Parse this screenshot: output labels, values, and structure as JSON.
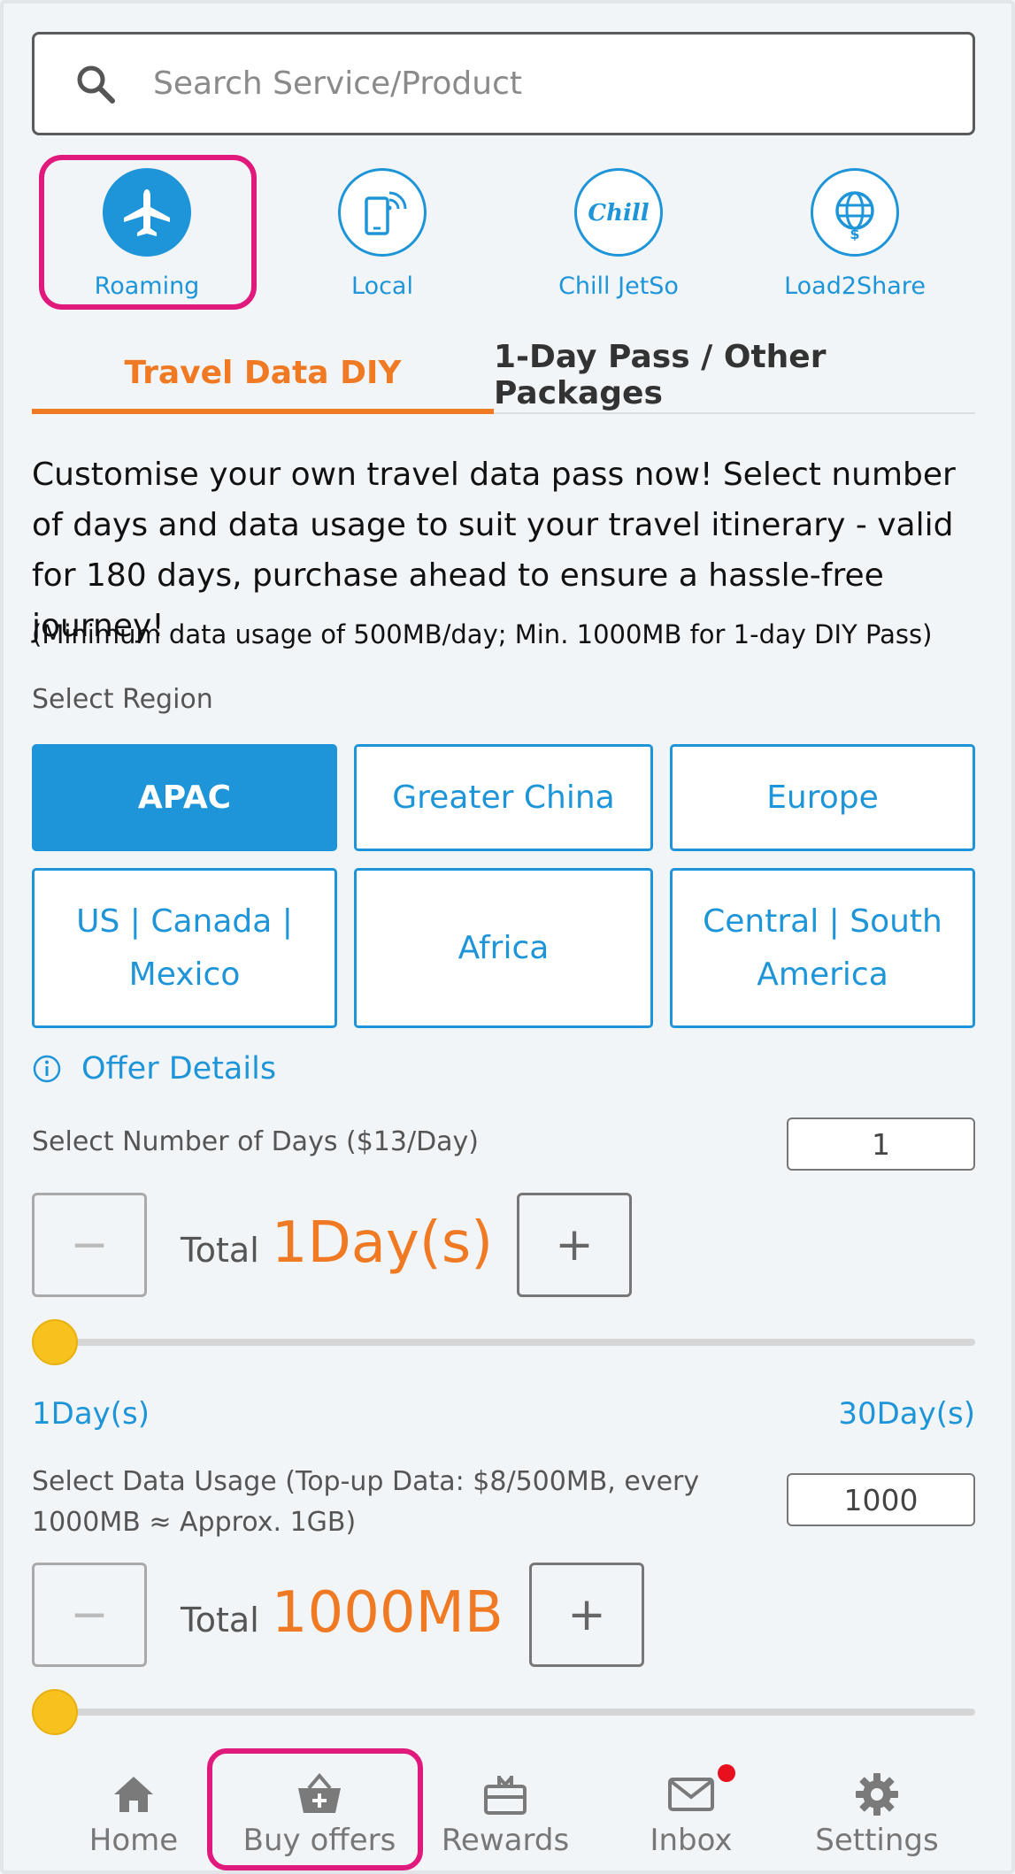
{
  "search": {
    "placeholder": "Search Service/Product"
  },
  "categories": [
    {
      "label": "Roaming",
      "icon": "airplane-icon",
      "active": true
    },
    {
      "label": "Local",
      "icon": "phone-signal-icon",
      "active": false
    },
    {
      "label": "Chill JetSo",
      "icon": "chill-logo-icon",
      "active": false
    },
    {
      "label": "Load2Share",
      "icon": "globe-dollar-icon",
      "active": false
    }
  ],
  "tabs": [
    {
      "label": "Travel Data DIY",
      "active": true
    },
    {
      "label": "1-Day Pass / Other Packages",
      "active": false
    }
  ],
  "description": "Customise your own travel data pass now! Select number of days and data usage to suit your travel itinerary - valid for 180 days, purchase ahead to ensure a hassle-free journey!",
  "note": "(Minimum data usage of 500MB/day; Min. 1000MB for 1-day DIY Pass)",
  "region": {
    "label": "Select Region",
    "options": [
      "APAC",
      "Greater China",
      "Europe",
      "US | Canada | Mexico",
      "Africa",
      "Central | South America"
    ],
    "selected": "APAC"
  },
  "offer_details": "Offer Details",
  "days": {
    "label": "Select Number of Days ($13/Day)",
    "value": "1",
    "total_label": "Total",
    "total_value": "1Day(s)",
    "minus": "−",
    "plus": "+",
    "min_label": "1Day(s)",
    "max_label": "30Day(s)",
    "slider_fraction": 0
  },
  "data_usage": {
    "label": "Select Data Usage (Top-up Data: $8/500MB, every 1000MB ≈ Approx. 1GB)",
    "value": "1000",
    "total_label": "Total",
    "total_value": "1000MB",
    "minus": "−",
    "plus": "+",
    "slider_fraction": 0
  },
  "nav": [
    {
      "label": "Home",
      "icon": "home-icon"
    },
    {
      "label": "Buy offers",
      "icon": "basket-icon"
    },
    {
      "label": "Rewards",
      "icon": "gift-icon"
    },
    {
      "label": "Inbox",
      "icon": "mail-icon",
      "badge": true
    },
    {
      "label": "Settings",
      "icon": "gear-icon"
    }
  ],
  "colors": {
    "accent": "#1e95d8",
    "orange": "#f07a24",
    "highlight": "#e0197d",
    "slider_thumb": "#f7c21e"
  }
}
